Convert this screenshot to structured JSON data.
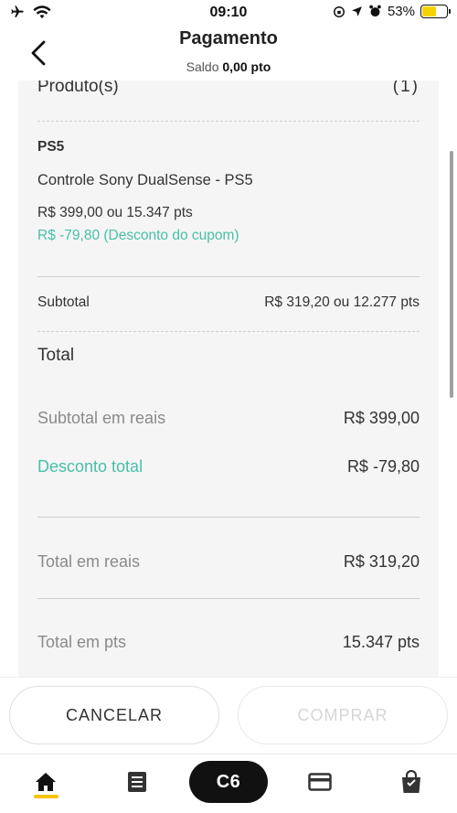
{
  "status_bar": {
    "time": "09:10",
    "battery": "53%",
    "battery_level": 0.53
  },
  "header": {
    "title": "Pagamento",
    "balance_label": "Saldo",
    "balance_value": "0,00 pto"
  },
  "card": {
    "section_title": "Produto(s)",
    "section_count": "(1)",
    "product_category": "PS5",
    "product_name": "Controle Sony DualSense - PS5",
    "product_price": "R$ 399,00 ou 15.347 pts",
    "coupon_discount": "R$ -79,80 (Desconto do cupom)",
    "subtotal_label": "Subtotal",
    "subtotal_value": "R$ 319,20 ou 12.277 pts",
    "total_title": "Total",
    "subtotal_reais_label": "Subtotal em reais",
    "subtotal_reais_value": "R$ 399,00",
    "discount_total_label": "Desconto total",
    "discount_total_value": "R$ -79,80",
    "total_reais_label": "Total em reais",
    "total_reais_value": "R$ 319,20",
    "total_pts_label": "Total em pts",
    "total_pts_value": "15.347 pts"
  },
  "footer": {
    "cancel_label": "CANCELAR",
    "buy_label": "COMPRAR"
  },
  "nav": {
    "items": [
      {
        "icon": "home-icon"
      },
      {
        "icon": "receipt-icon"
      },
      {
        "label": "C6"
      },
      {
        "icon": "card-icon"
      },
      {
        "icon": "shopping-bag-icon"
      }
    ]
  },
  "colors": {
    "accent_green": "#48bfa7",
    "nav_active": "#f5c400"
  }
}
